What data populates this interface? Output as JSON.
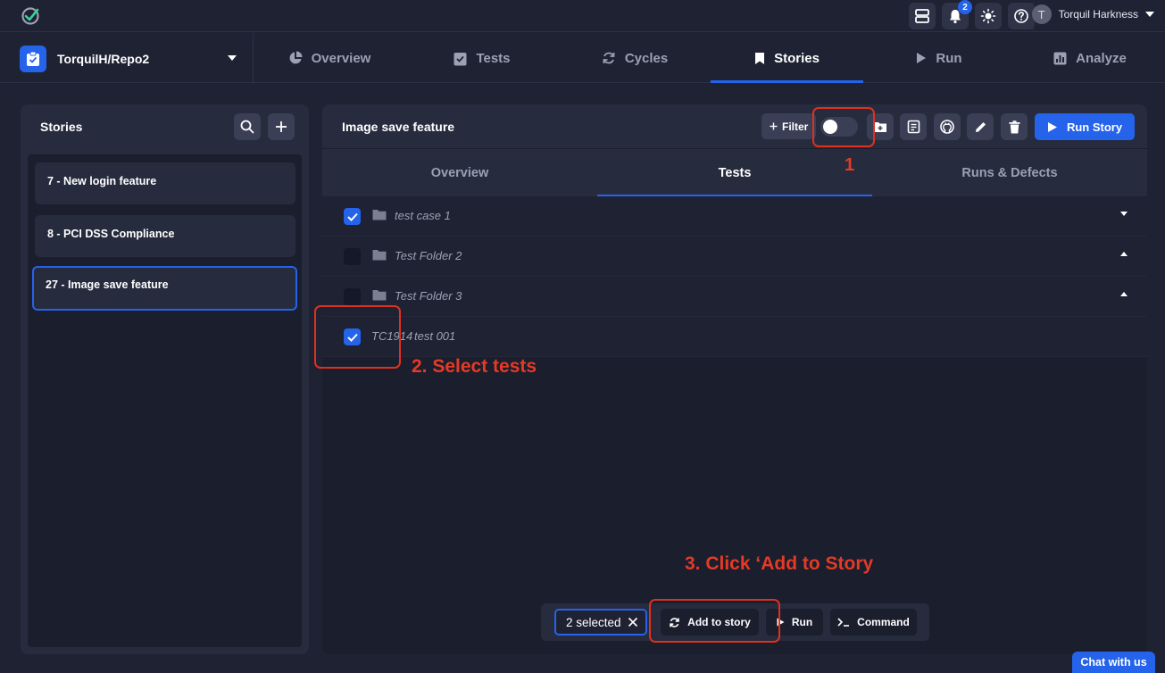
{
  "colors": {
    "accent": "#2563eb",
    "annotation": "#e53a26",
    "background": "#1e2233"
  },
  "topbar": {
    "icons": [
      "dashboard-icon",
      "bell-icon",
      "sun-icon",
      "help-icon"
    ],
    "notification_count": "2",
    "user": {
      "initial": "T",
      "name": "Torquil Harkness"
    }
  },
  "nav": {
    "repo": "TorquilH/Repo2",
    "tabs": [
      {
        "label": "Overview",
        "icon": "pie-chart-icon"
      },
      {
        "label": "Tests",
        "icon": "clipboard-check-icon"
      },
      {
        "label": "Cycles",
        "icon": "refresh-icon"
      },
      {
        "label": "Stories",
        "icon": "bookmark-icon",
        "active": true
      },
      {
        "label": "Run",
        "icon": "play-icon"
      },
      {
        "label": "Analyze",
        "icon": "bar-chart-icon"
      }
    ]
  },
  "stories_panel": {
    "title": "Stories",
    "items": [
      {
        "label": "7 - New login feature"
      },
      {
        "label": "8 - PCI DSS Compliance"
      },
      {
        "label": "27 - Image save feature",
        "active": true
      }
    ]
  },
  "story_detail": {
    "title": "Image save feature",
    "filter_label": "Filter",
    "run_story_label": "Run Story",
    "tabs": [
      "Overview",
      "Tests",
      "Runs & Defects"
    ],
    "active_tab": "Tests",
    "rows": [
      {
        "label": "test case 1",
        "type": "folder",
        "checked": true,
        "expanded": false
      },
      {
        "label": "Test Folder 2",
        "type": "folder",
        "checked": false,
        "expanded": true
      },
      {
        "label": "Test Folder 3",
        "type": "folder",
        "checked": false,
        "expanded": true
      },
      {
        "id": "TC1914",
        "label": "test 001",
        "type": "test",
        "checked": true
      }
    ]
  },
  "annotations": {
    "step1": "1",
    "step2": "2. Select tests",
    "step3": "3. Click ‘Add to Story"
  },
  "action_bar": {
    "selected": "2 selected",
    "add_to_story": "Add to story",
    "run": "Run",
    "command": "Command"
  },
  "chat_label": "Chat with us"
}
